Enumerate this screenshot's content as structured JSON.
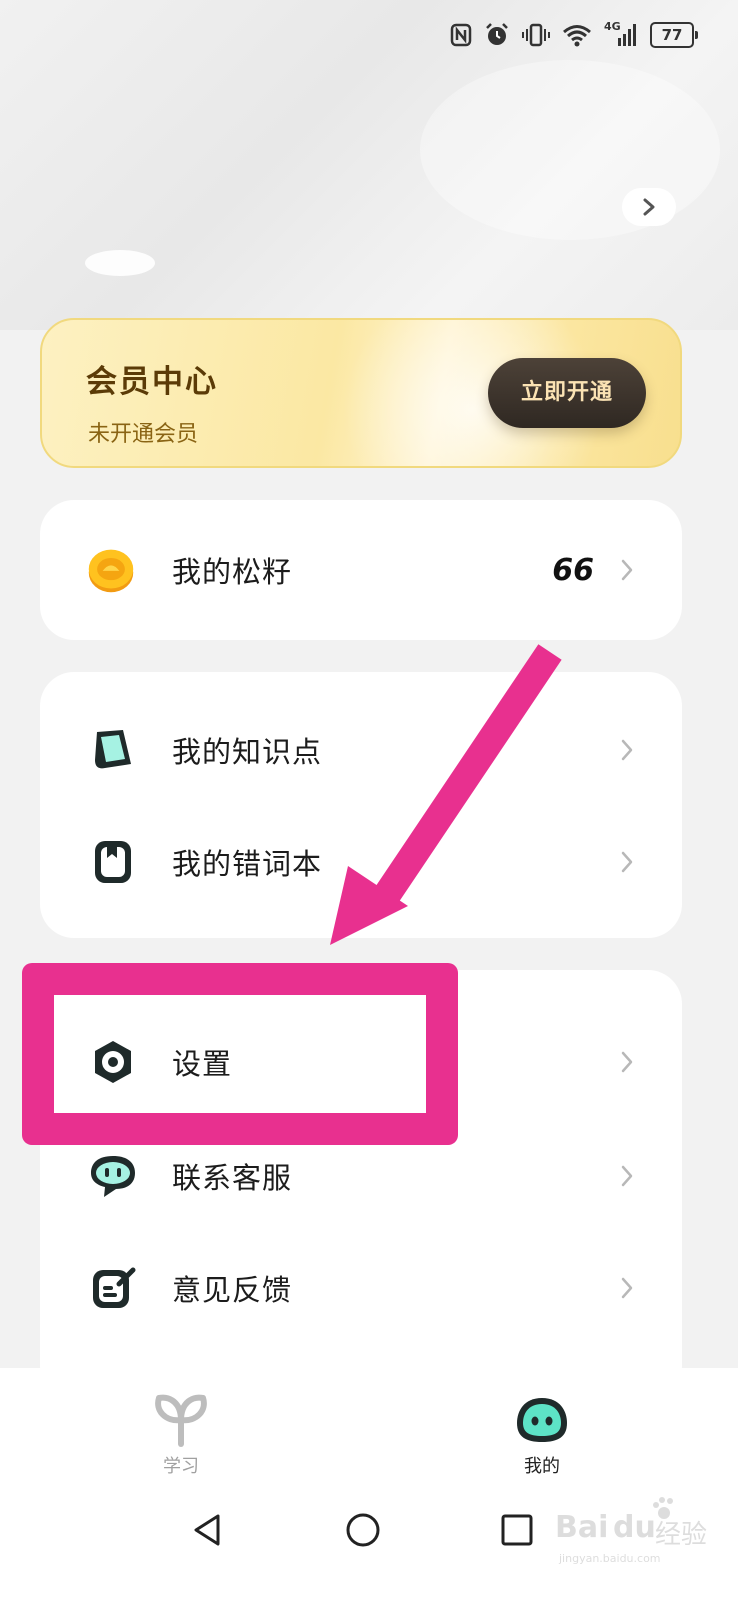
{
  "status_bar": {
    "battery_level": "77",
    "network_label": "4G"
  },
  "vip": {
    "title": "会员中心",
    "subtitle": "未开通会员",
    "button_label": "立即开通"
  },
  "coins_row": {
    "label": "我的松籽",
    "value": "66",
    "icon": "coin-icon"
  },
  "group_study": [
    {
      "label": "我的知识点",
      "icon": "knowledge-icon"
    },
    {
      "label": "我的错词本",
      "icon": "wordbook-icon"
    }
  ],
  "group_settings": [
    {
      "label": "设置",
      "icon": "settings-icon"
    },
    {
      "label": "联系客服",
      "icon": "customer-service-icon"
    },
    {
      "label": "意见反馈",
      "icon": "feedback-icon"
    }
  ],
  "bottom_nav": [
    {
      "label": "学习",
      "icon": "sprout-icon",
      "active": false
    },
    {
      "label": "我的",
      "icon": "profile-blob-icon",
      "active": true
    }
  ],
  "colors": {
    "annotation": "#e8308f",
    "vip_gold": "#fbe8a3",
    "mascot_teal": "#5de3c6"
  },
  "watermark": {
    "brand": "Bai",
    "brand_suffix": "du",
    "cn_text": "经验",
    "url": "jingyan.baidu.com"
  }
}
